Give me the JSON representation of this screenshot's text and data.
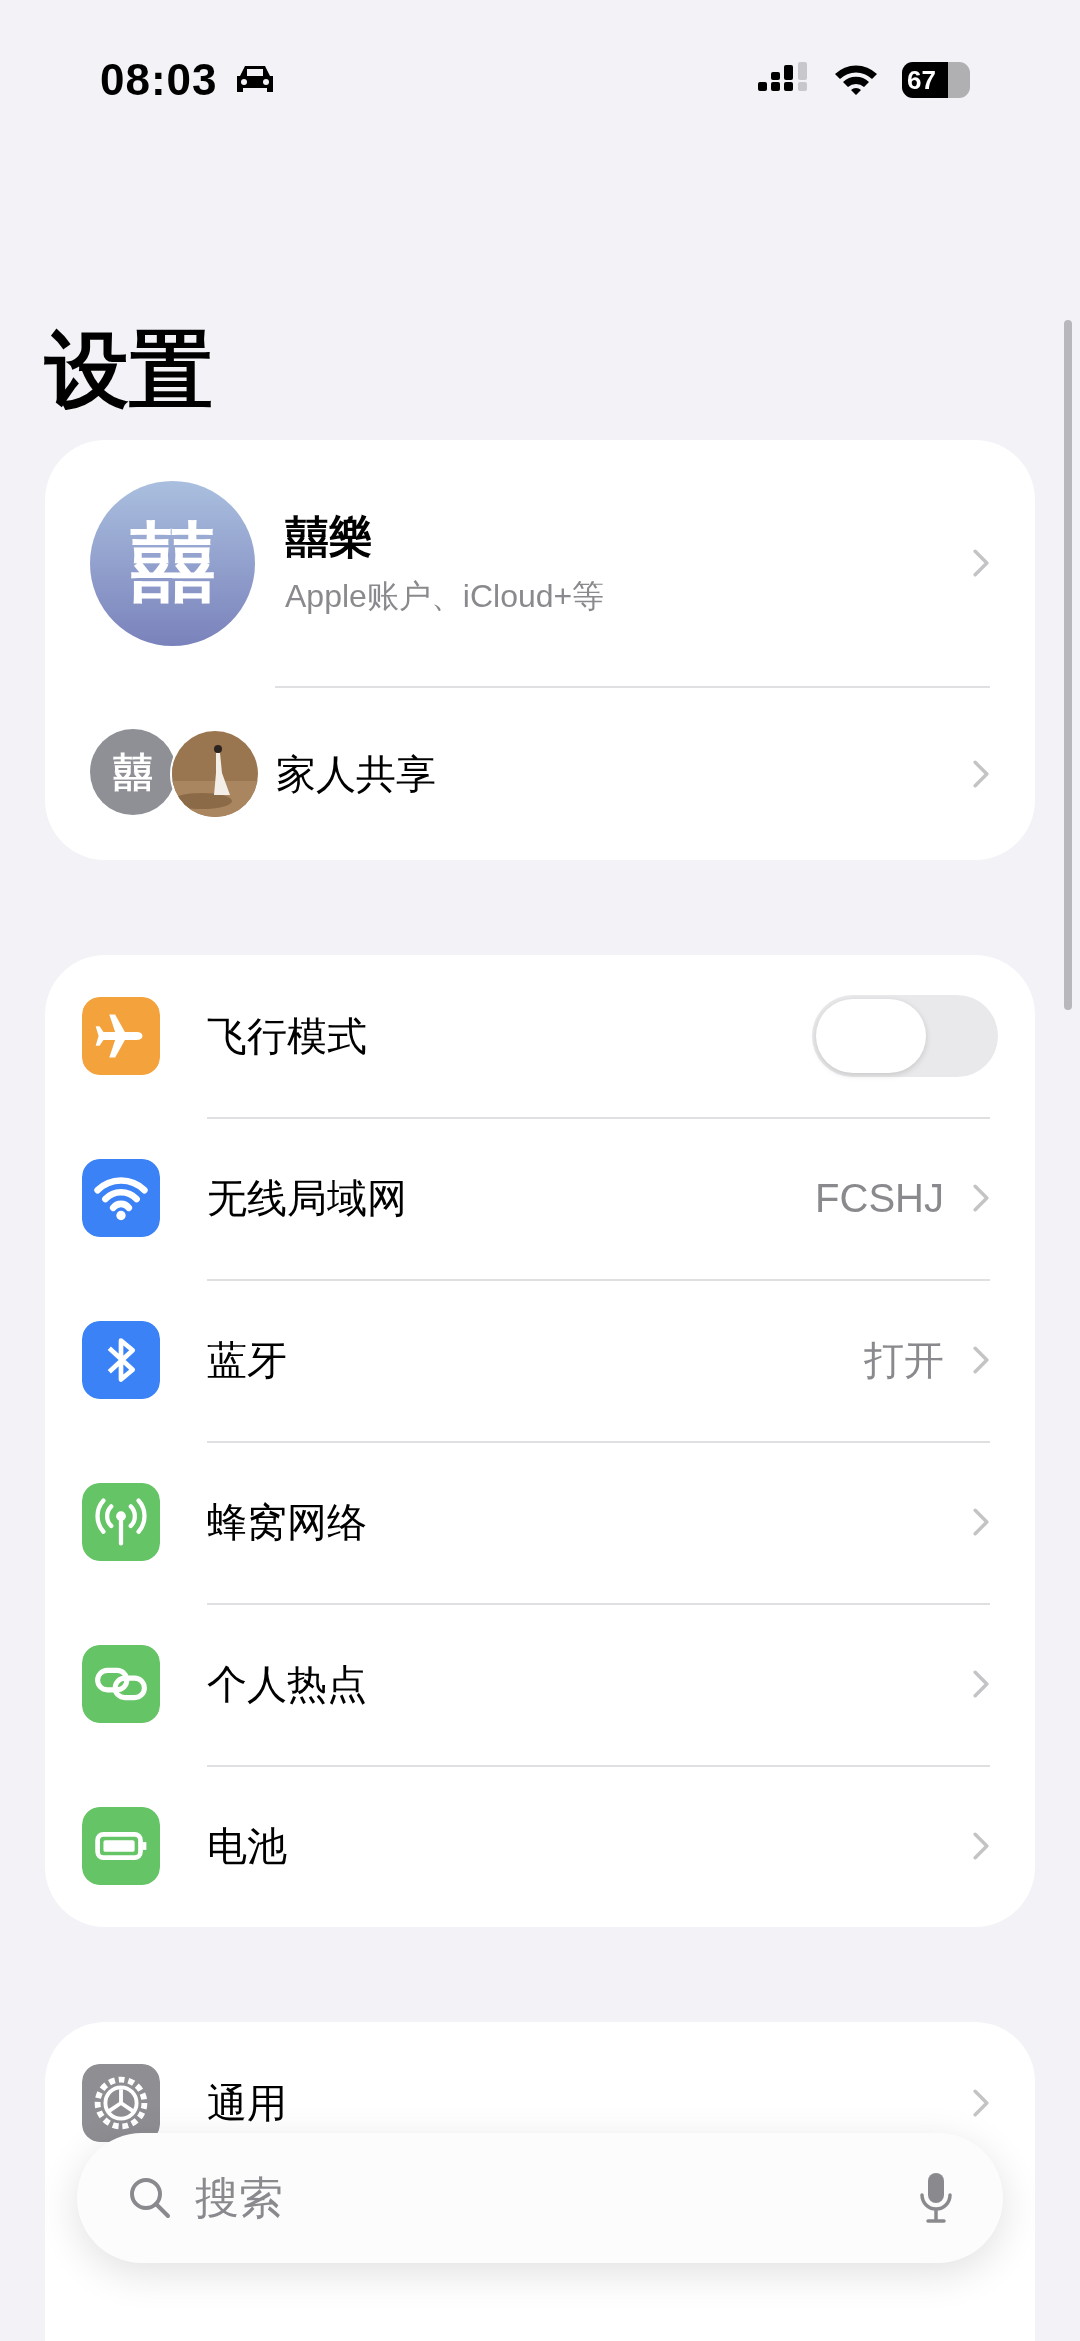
{
  "status_bar": {
    "time": "08:03",
    "battery": "67"
  },
  "title": "设置",
  "account": {
    "avatar_text": "囍",
    "name": "囍樂",
    "subtitle": "Apple账户、iCloud+等",
    "family": {
      "avatar_text": "囍",
      "label": "家人共享"
    }
  },
  "connectivity": [
    {
      "kind": "toggle",
      "label": "飞行模式",
      "color": "#f4a23c",
      "on": false
    },
    {
      "kind": "value",
      "label": "无线局域网",
      "color": "#3b82f6",
      "value": "FCSHJ"
    },
    {
      "kind": "value",
      "label": "蓝牙",
      "color": "#3b82f6",
      "value": "打开"
    },
    {
      "kind": "link",
      "label": "蜂窝网络",
      "color": "#65c466"
    },
    {
      "kind": "link",
      "label": "个人热点",
      "color": "#65c466"
    },
    {
      "kind": "link",
      "label": "电池",
      "color": "#65c466"
    }
  ],
  "general": [
    {
      "kind": "link",
      "label": "通用",
      "color": "#8e8e93"
    }
  ],
  "search": {
    "placeholder": "搜索"
  }
}
